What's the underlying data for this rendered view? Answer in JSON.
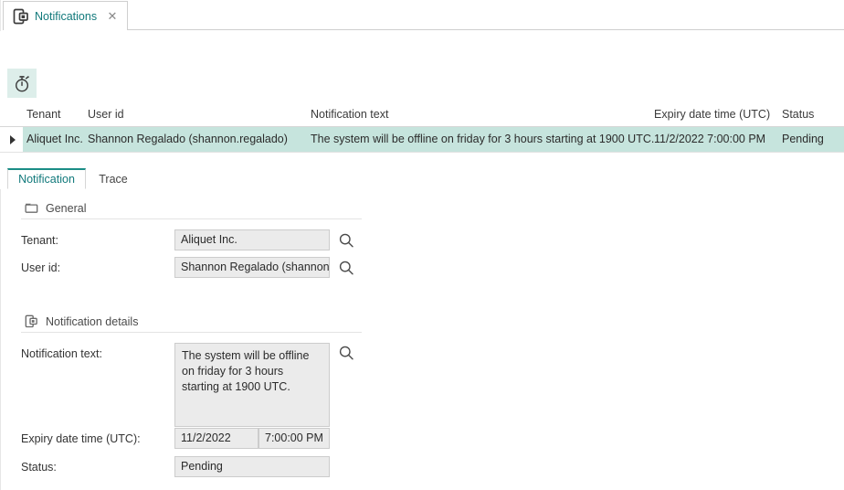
{
  "window": {
    "doc_tab": {
      "label": "Notifications",
      "icon": "notification-device-icon",
      "close_label": "✕"
    }
  },
  "toolbar": {
    "buttons": [
      {
        "name": "timer-button",
        "icon": "stopwatch-icon",
        "active": true
      }
    ]
  },
  "grid": {
    "columns": [
      {
        "key": "tenant",
        "label": "Tenant"
      },
      {
        "key": "user_id",
        "label": "User id"
      },
      {
        "key": "notification_text",
        "label": "Notification text"
      },
      {
        "key": "expiry",
        "label": "Expiry date time (UTC)"
      },
      {
        "key": "status",
        "label": "Status"
      }
    ],
    "rows": [
      {
        "selected": true,
        "tenant": "Aliquet Inc.",
        "user_id": "Shannon Regalado (shannon.regalado)",
        "notification_text": "The system will be offline on friday for 3 hours starting at 1900 UTC.",
        "expiry": "11/2/2022 7:00:00 PM",
        "status": "Pending"
      }
    ],
    "selection_color": "#c6e4dd"
  },
  "detail_tabs": [
    {
      "label": "Notification",
      "active": true
    },
    {
      "label": "Trace",
      "active": false
    }
  ],
  "form": {
    "sections": [
      {
        "title": "General",
        "icon": "folder-icon",
        "fields": [
          {
            "label": "Tenant:",
            "value": "Aliquet Inc.",
            "lookup": true
          },
          {
            "label": "User id:",
            "value": "Shannon Regalado (shannon.",
            "lookup": true
          }
        ]
      },
      {
        "title": "Notification details",
        "icon": "notification-device-icon",
        "fields": [
          {
            "label": "Notification text:",
            "value": "The system will be offline on friday for 3 hours starting at 1900 UTC.",
            "lookup": true
          },
          {
            "label": "Expiry date time (UTC):",
            "date_value": "11/2/2022",
            "time_value": "7:00:00 PM"
          },
          {
            "label": "Status:",
            "value": "Pending"
          }
        ]
      }
    ]
  },
  "colors": {
    "accent": "#11797b",
    "tab_active_border": "#1a8d86",
    "selection": "#c6e4dd",
    "toolbar_active_bg": "#ddeeea",
    "field_bg": "#ebebeb",
    "field_border": "#cccccc"
  }
}
